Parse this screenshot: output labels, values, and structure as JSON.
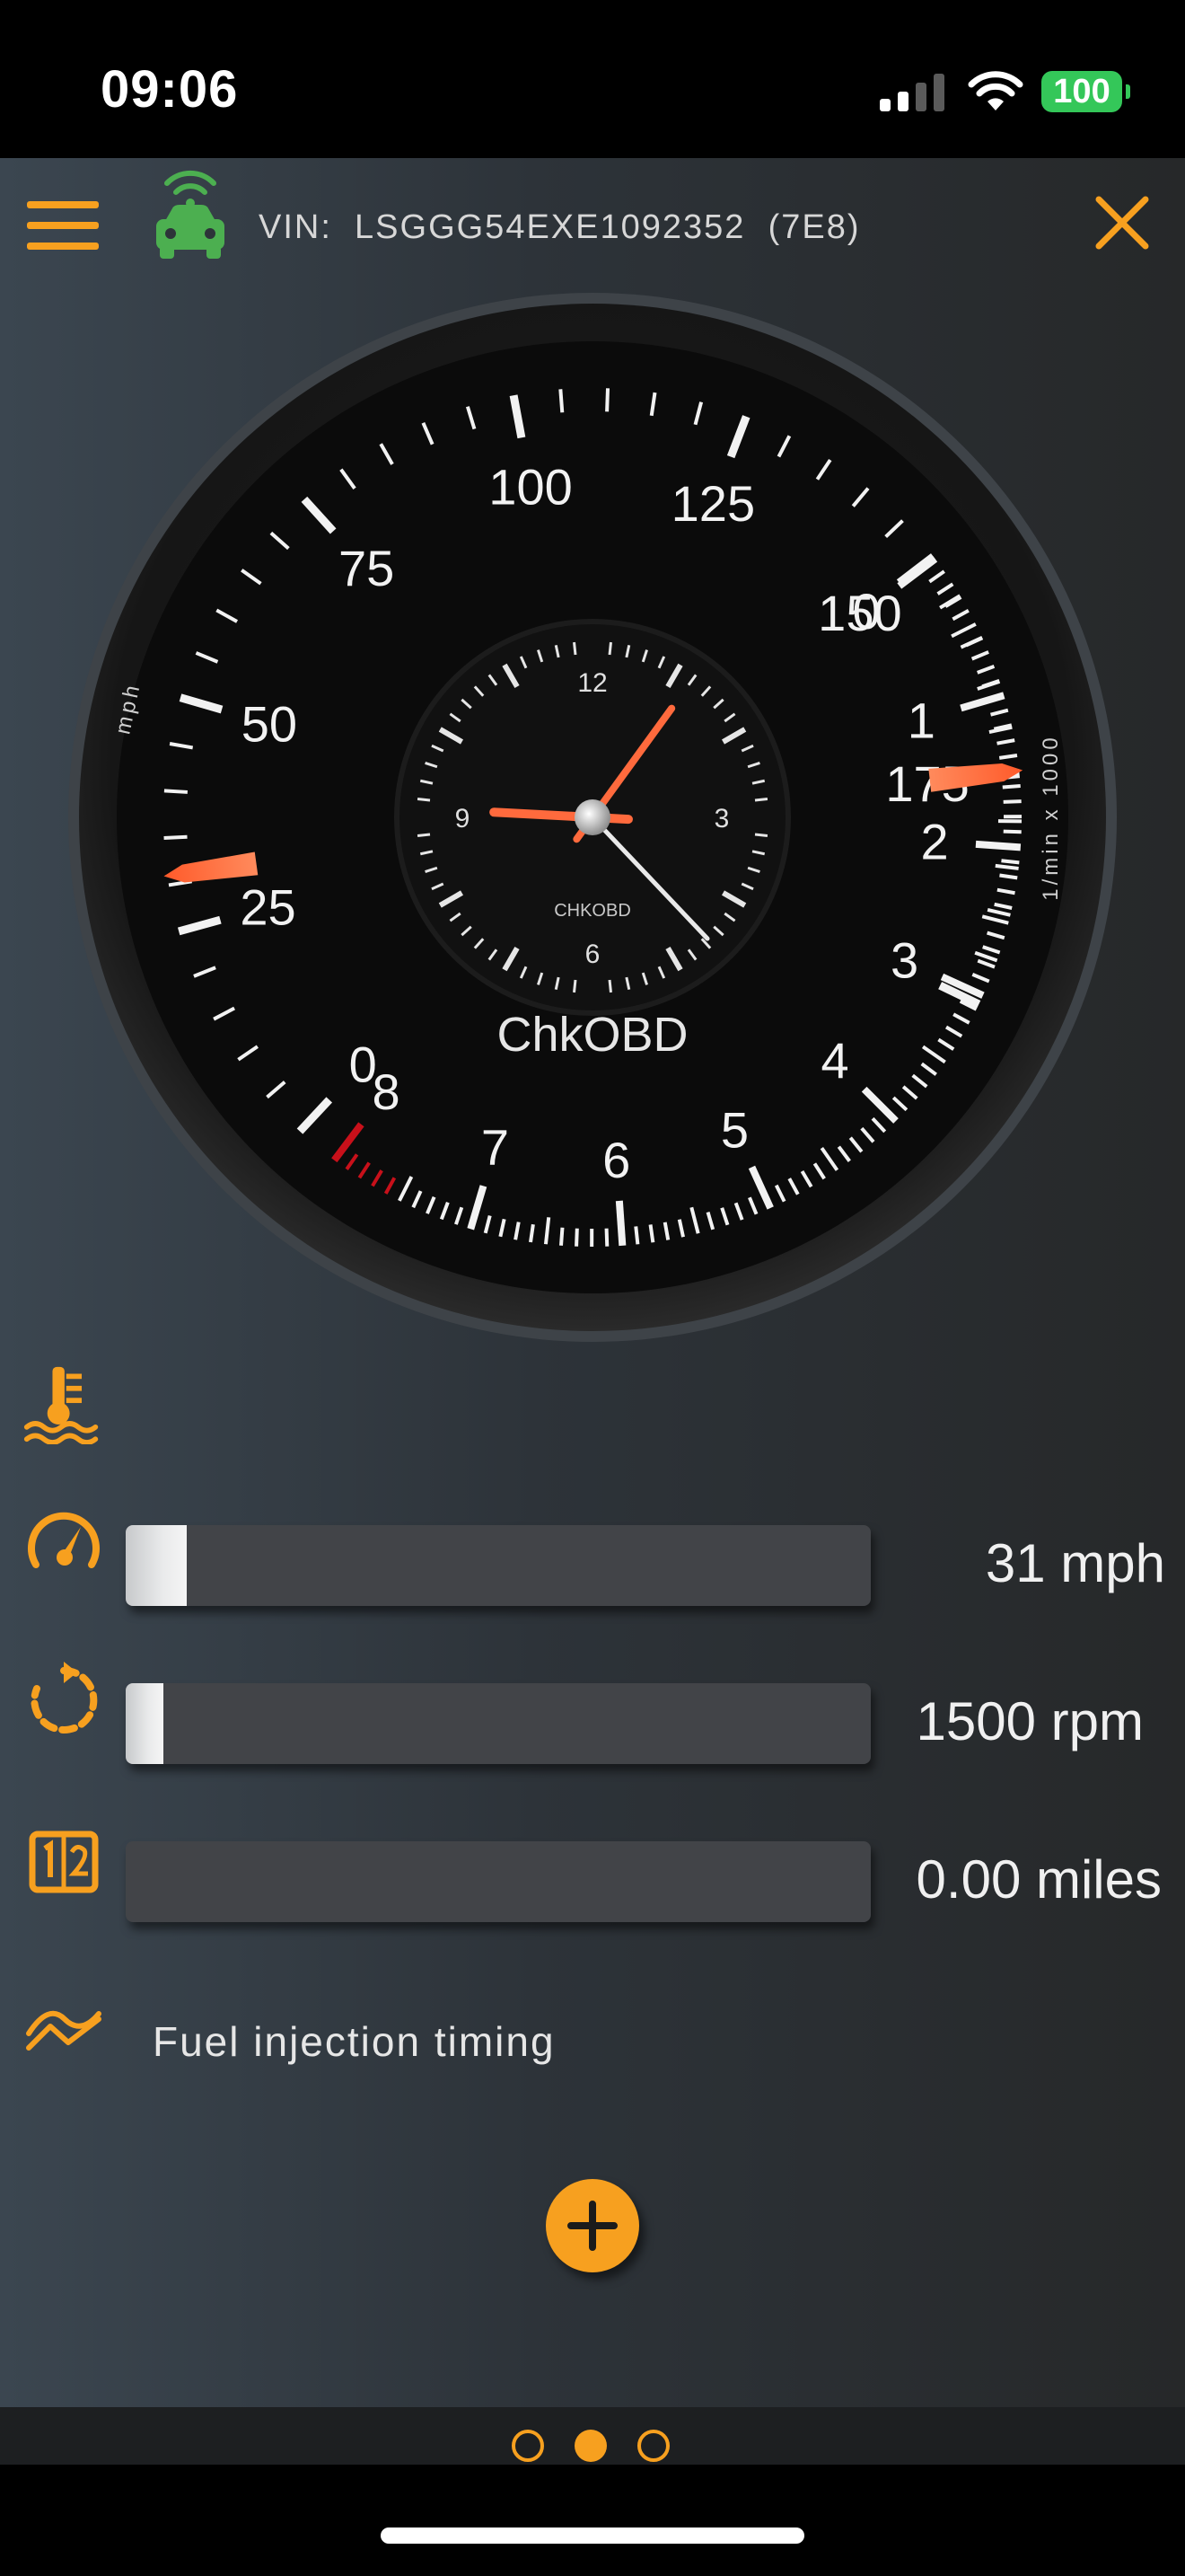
{
  "status_bar": {
    "time": "09:06",
    "battery": "100"
  },
  "topbar": {
    "vin_label": "VIN:",
    "vin": "LSGGG54EXE1092352",
    "ecu": "(7E8)"
  },
  "gauge": {
    "brand": "ChkOBD",
    "speed_unit": "mph",
    "rpm_unit": "1/min x 1000",
    "speed_labels": [
      "0",
      "25",
      "50",
      "75",
      "100",
      "125",
      "150",
      "175"
    ],
    "rpm_labels": [
      "0",
      "1",
      "2",
      "3",
      "4",
      "5",
      "6",
      "7",
      "8"
    ],
    "speed_value": 31,
    "rpm_value": 1.5,
    "clock": {
      "brand": "CHKOBD",
      "numerals": [
        "12",
        "3",
        "6",
        "9"
      ],
      "hour": 9,
      "minute": 6
    },
    "colors": {
      "needle": "#ff6a3d",
      "redline": "#c8101a",
      "face": "#0b0b0b"
    }
  },
  "strips": {
    "speed": {
      "value": "31",
      "unit": "mph",
      "fill_fraction": 0.082
    },
    "rpm": {
      "value": "1500",
      "unit": "rpm",
      "fill_fraction": 0.05
    },
    "distance": {
      "value": "0.00",
      "unit": "miles",
      "fill_fraction": 0
    },
    "fuel_label": "Fuel injection timing"
  },
  "pager": {
    "pages": 3,
    "active": 1
  },
  "colors": {
    "accent": "#f7a01f",
    "car_connected": "#4caf50"
  }
}
